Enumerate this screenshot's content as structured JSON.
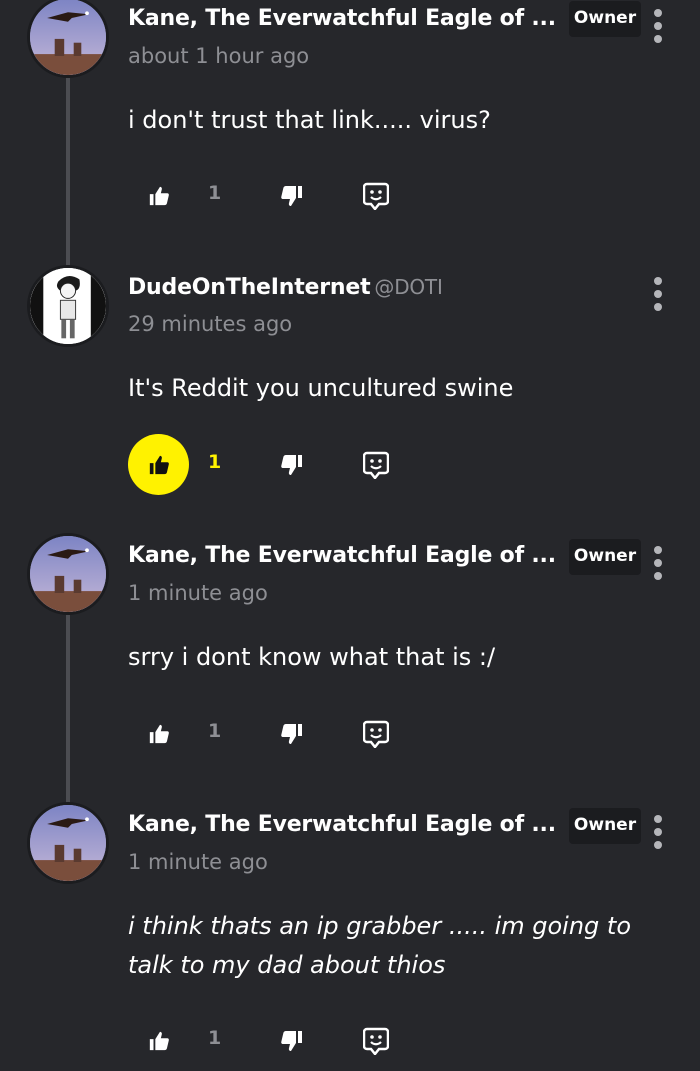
{
  "comments": [
    {
      "author": "Kane, The Everwatchful Eagle of ...",
      "handle": "",
      "badge": "Owner",
      "time": "about 1 hour ago",
      "text": "i don't trust that link..... virus?",
      "likes": "1",
      "liked": false,
      "avatar": "eagle-desert-avatar"
    },
    {
      "author": "DudeOnTheInternet",
      "handle": "@DOTI",
      "badge": "",
      "time": "29 minutes ago",
      "text": "It's Reddit you uncultured swine",
      "likes": "1",
      "liked": true,
      "avatar": "drawn-character-avatar"
    },
    {
      "author": "Kane, The Everwatchful Eagle of ...",
      "handle": "",
      "badge": "Owner",
      "time": "1 minute ago",
      "text": "srry i dont know what that is :/",
      "likes": "1",
      "liked": false,
      "avatar": "eagle-desert-avatar"
    },
    {
      "author": "Kane, The Everwatchful Eagle of ...",
      "handle": "",
      "badge": "Owner",
      "time": "1 minute ago",
      "text": "i think thats an ip grabber ..... im going to talk to my dad about thios",
      "likes": "1",
      "liked": false,
      "avatar": "eagle-desert-avatar"
    }
  ],
  "colors": {
    "background": "#26272b",
    "active_like": "#fff200",
    "muted_text": "#8e8f94",
    "badge_bg": "#1b1c1f"
  },
  "icons": [
    "thumbs-up-icon",
    "thumbs-down-icon",
    "reply-icon",
    "more-options-icon"
  ]
}
